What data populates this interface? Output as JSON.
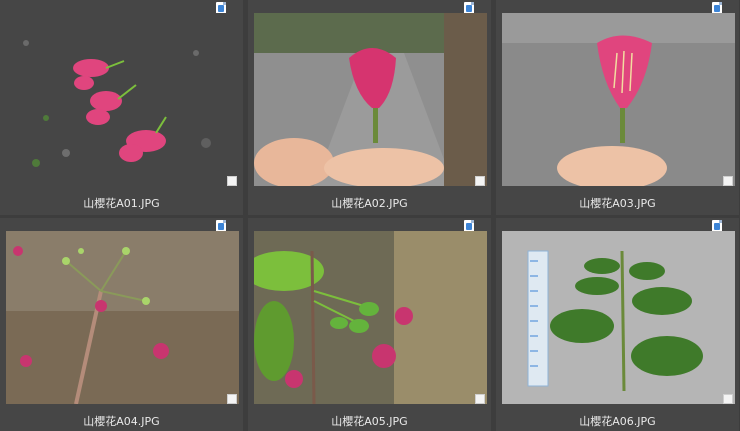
{
  "files": [
    {
      "name": "山櫻花A01.JPG",
      "icon": "image-file-icon"
    },
    {
      "name": "山櫻花A02.JPG",
      "icon": "image-file-icon"
    },
    {
      "name": "山櫻花A03.JPG",
      "icon": "image-file-icon"
    },
    {
      "name": "山櫻花A04.JPG",
      "icon": "image-file-icon"
    },
    {
      "name": "山櫻花A05.JPG",
      "icon": "image-file-icon"
    },
    {
      "name": "山櫻花A06.JPG",
      "icon": "image-file-icon"
    }
  ],
  "colors": {
    "background": "#3c3c3c",
    "tile": "#464646",
    "blossom": "#e0457e",
    "caption": "#e9e9e9"
  }
}
